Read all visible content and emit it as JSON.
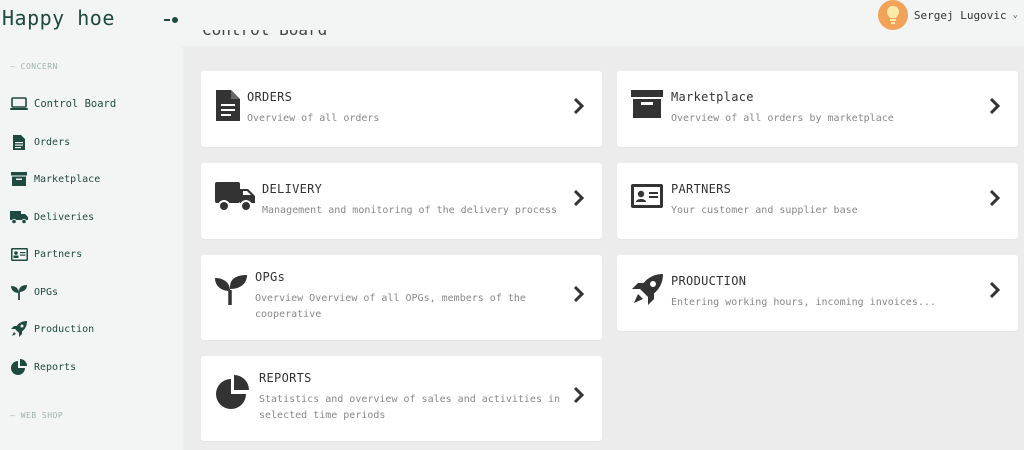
{
  "app": {
    "brand": "Happy hoe"
  },
  "user": {
    "name": "Sergej Lugovic",
    "chevron": "⌄"
  },
  "sidebar": {
    "section_concern": "— CONCERN",
    "section_webshop": "— WEB SHOP",
    "items": [
      {
        "label": "Control Board",
        "icon": "laptop-icon"
      },
      {
        "label": "Orders",
        "icon": "document-icon"
      },
      {
        "label": "Marketplace",
        "icon": "archive-icon"
      },
      {
        "label": "Deliveries",
        "icon": "truck-icon"
      },
      {
        "label": "Partners",
        "icon": "id-card-icon"
      },
      {
        "label": "OPGs",
        "icon": "seedling-icon"
      },
      {
        "label": "Production",
        "icon": "rocket-icon"
      },
      {
        "label": "Reports",
        "icon": "pie-chart-icon"
      }
    ]
  },
  "content": {
    "title": "Control Board",
    "cards": [
      {
        "title": "ORDERS",
        "desc": "Overview of all orders",
        "icon": "document-icon"
      },
      {
        "title": "Marketplace",
        "desc": "Overview of all orders by marketplace",
        "icon": "archive-icon"
      },
      {
        "title": "DELIVERY",
        "desc": "Management and monitoring of the delivery process",
        "icon": "truck-icon"
      },
      {
        "title": "PARTNERS",
        "desc": "Your customer and supplier base",
        "icon": "id-card-icon"
      },
      {
        "title": "OPGs",
        "desc": "Overview Overview of all OPGs, members of the cooperative",
        "icon": "seedling-icon"
      },
      {
        "title": "PRODUCTION",
        "desc": "Entering working hours, incoming invoices...",
        "icon": "rocket-icon"
      },
      {
        "title": "REPORTS",
        "desc": "Statistics and overview of sales and activities in selected time periods",
        "icon": "pie-chart-icon"
      }
    ]
  },
  "colors": {
    "brand": "#1e4a40",
    "sidebar_bg": "#f3f5f4",
    "content_bg": "#ececec",
    "icon_dark": "#333333",
    "avatar": "#f2a35a"
  }
}
